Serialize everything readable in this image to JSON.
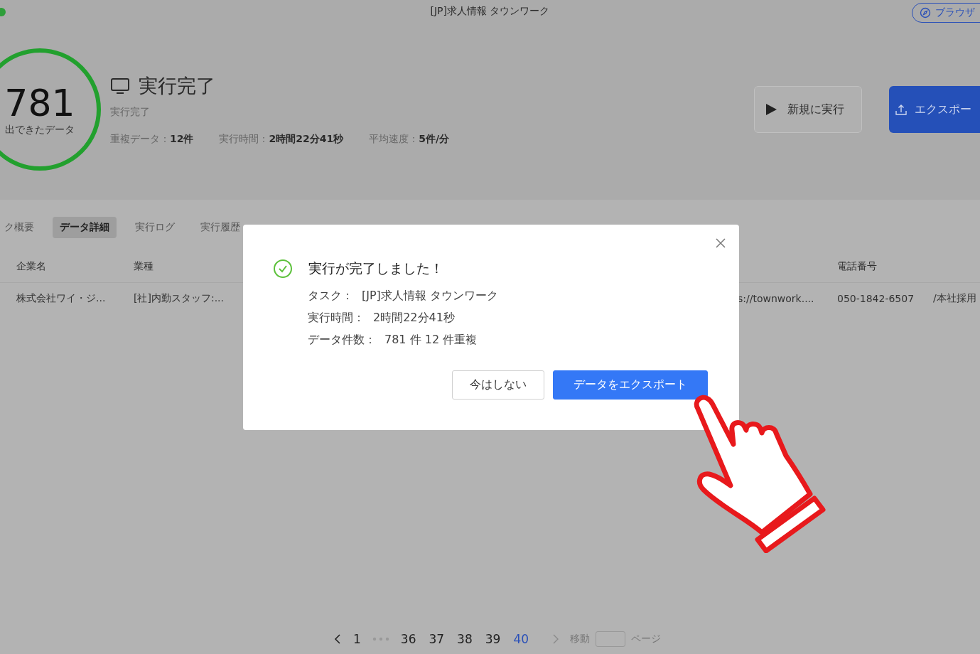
{
  "window": {
    "title": "[JP]求人情報 タウンワーク",
    "browser_button": "ブラウザ"
  },
  "summary": {
    "count": "781",
    "count_label": "出できたデータ",
    "status_title": "実行完了",
    "status_sub": "実行完了",
    "stats": [
      {
        "label": "重複データ：",
        "value": "12件"
      },
      {
        "label": "実行時間：",
        "value": "2時間22分41秒"
      },
      {
        "label": "平均速度：",
        "value": "5件/分"
      }
    ]
  },
  "actions": [
    {
      "kind": "secondary",
      "label": "新規に実行"
    },
    {
      "kind": "primary",
      "label": "エクスポー"
    }
  ],
  "tabs": [
    {
      "label": "ク概要",
      "selected": false
    },
    {
      "label": "データ詳細",
      "selected": true
    },
    {
      "label": "実行ログ",
      "selected": false
    },
    {
      "label": "実行履歴",
      "selected": false
    }
  ],
  "table": {
    "columns": [
      "企業名",
      "業種",
      "",
      "電話番号",
      ""
    ],
    "rows": [
      [
        "株式会社ワイ・ジ...",
        "[社]内勤スタッフ:...",
        "s://townwork....",
        "050-1842-6507",
        "/本社採用"
      ]
    ]
  },
  "modal": {
    "title": "実行が完了しました！",
    "details": [
      {
        "label": "タスク：",
        "value": "[JP]求人情報 タウンワーク"
      },
      {
        "label": "実行時間：",
        "value": "2時間22分41秒"
      },
      {
        "label": "データ件数：",
        "value": "781 件 12 件重複"
      }
    ],
    "buttons": [
      {
        "kind": "default",
        "label": "今はしない"
      },
      {
        "kind": "primary",
        "label": "データをエクスポート"
      }
    ]
  },
  "pagination": {
    "pages": [
      {
        "label": "1",
        "selected": false
      },
      {
        "label": "36",
        "selected": false
      },
      {
        "label": "37",
        "selected": false
      },
      {
        "label": "38",
        "selected": false
      },
      {
        "label": "39",
        "selected": false
      },
      {
        "label": "40",
        "selected": true
      }
    ],
    "jump_label": "移動",
    "page_suffix": "ページ"
  }
}
